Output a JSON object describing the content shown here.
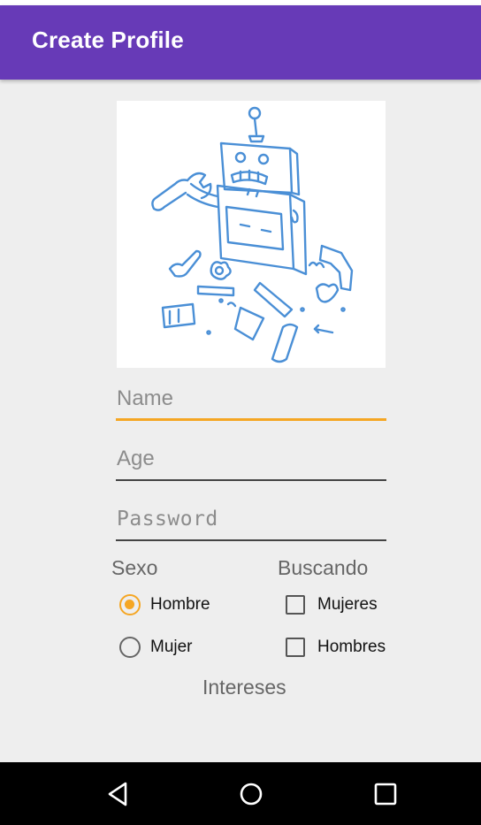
{
  "app_bar": {
    "title": "Create Profile",
    "color": "#673ab7"
  },
  "form": {
    "name_placeholder": "Name",
    "age_placeholder": "Age",
    "password_placeholder": "Password"
  },
  "sexo": {
    "label": "Sexo",
    "options": [
      {
        "label": "Hombre",
        "selected": true
      },
      {
        "label": "Mujer",
        "selected": false
      }
    ]
  },
  "buscando": {
    "label": "Buscando",
    "options": [
      {
        "label": "Mujeres",
        "checked": false
      },
      {
        "label": "Hombres",
        "checked": false
      }
    ]
  },
  "intereses": {
    "label": "Intereses"
  },
  "nav": {
    "icons": [
      "back-icon",
      "home-icon",
      "recents-icon"
    ]
  },
  "colors": {
    "accent": "#f5a623",
    "primary": "#673ab7"
  }
}
